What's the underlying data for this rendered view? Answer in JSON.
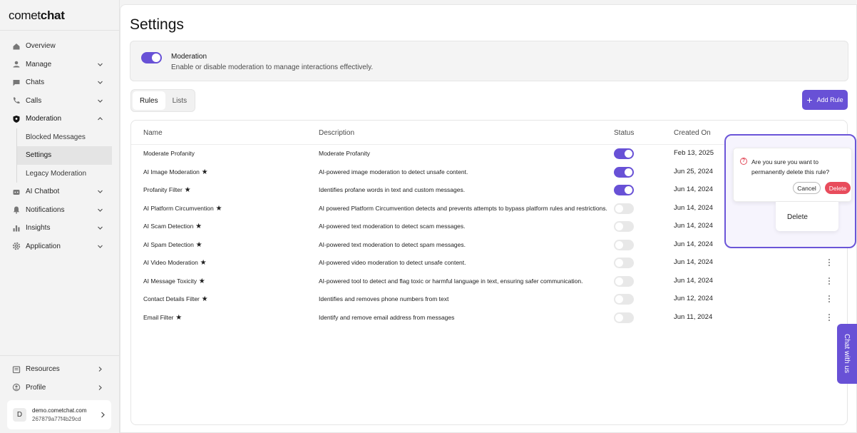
{
  "brand": {
    "prefix": "comet",
    "suffix": "chat"
  },
  "sidebar": {
    "items": [
      {
        "label": "Overview",
        "icon": "home-icon"
      },
      {
        "label": "Manage",
        "icon": "user-icon"
      },
      {
        "label": "Chats",
        "icon": "chat-icon"
      },
      {
        "label": "Calls",
        "icon": "phone-icon"
      },
      {
        "label": "Moderation",
        "icon": "shield-icon"
      }
    ],
    "moderation_sub": [
      "Blocked Messages",
      "Settings",
      "Legacy Moderation"
    ],
    "items_after": [
      {
        "label": "AI Chatbot",
        "icon": "bot-icon"
      },
      {
        "label": "Notifications",
        "icon": "bell-icon"
      },
      {
        "label": "Insights",
        "icon": "chart-icon"
      },
      {
        "label": "Application",
        "icon": "gear-icon"
      }
    ],
    "bottom": [
      {
        "label": "Resources",
        "icon": "book-icon"
      },
      {
        "label": "Profile",
        "icon": "profile-icon"
      }
    ],
    "account": {
      "avatar": "D",
      "name": "demo.cometchat.com",
      "id": "267879a77f4b29cd"
    }
  },
  "page": {
    "title": "Settings"
  },
  "moderation_card": {
    "title": "Moderation",
    "description": "Enable or disable moderation to manage interactions effectively.",
    "enabled": true
  },
  "tabs": [
    {
      "label": "Rules",
      "active": true
    },
    {
      "label": "Lists",
      "active": false
    }
  ],
  "add_rule_label": "Add Rule",
  "table": {
    "headers": {
      "name": "Name",
      "description": "Description",
      "status": "Status",
      "created_on": "Created On"
    },
    "rows": [
      {
        "name": "Moderate Profanity",
        "starred": false,
        "description": "Moderate Profanity",
        "enabled": true,
        "created_on": "Feb 13, 2025"
      },
      {
        "name": "AI Image Moderation",
        "starred": true,
        "description": "AI-powered image moderation to detect unsafe content.",
        "enabled": true,
        "created_on": "Jun 25, 2024"
      },
      {
        "name": "Profanity Filter",
        "starred": true,
        "description": "Identifies profane words in text and custom messages.",
        "enabled": true,
        "created_on": "Jun 14, 2024"
      },
      {
        "name": "AI Platform Circumvention",
        "starred": true,
        "description": "AI powered Platform Circumvention detects and prevents attempts to bypass platform rules and restrictions.",
        "enabled": false,
        "created_on": "Jun 14, 2024"
      },
      {
        "name": "AI Scam Detection",
        "starred": true,
        "description": "AI-powered text moderation to detect scam messages.",
        "enabled": false,
        "created_on": "Jun 14, 2024"
      },
      {
        "name": "AI Spam Detection",
        "starred": true,
        "description": "AI-powered text moderation to detect spam messages.",
        "enabled": false,
        "created_on": "Jun 14, 2024"
      },
      {
        "name": "AI Video Moderation",
        "starred": true,
        "description": "AI-powered video moderation to detect unsafe content.",
        "enabled": false,
        "created_on": "Jun 14, 2024"
      },
      {
        "name": "AI Message Toxicity",
        "starred": true,
        "description": "AI-powered tool to detect and flag toxic or harmful language in text, ensuring safer communication.",
        "enabled": false,
        "created_on": "Jun 14, 2024"
      },
      {
        "name": "Contact Details Filter",
        "starred": true,
        "description": "Identifies and removes phone numbers from text",
        "enabled": false,
        "created_on": "Jun 12, 2024"
      },
      {
        "name": "Email Filter",
        "starred": true,
        "description": "Identify and remove email address from messages",
        "enabled": false,
        "created_on": "Jun 11, 2024"
      }
    ]
  },
  "confirm_popup": {
    "message": "Are you sure you want to permanently delete this rule?",
    "cancel_label": "Cancel",
    "delete_label": "Delete"
  },
  "row_menu": {
    "delete_label": "Delete"
  },
  "chat_widget": {
    "label": "Chat with us"
  },
  "colors": {
    "accent": "#6851d6",
    "danger": "#e84c5c"
  }
}
